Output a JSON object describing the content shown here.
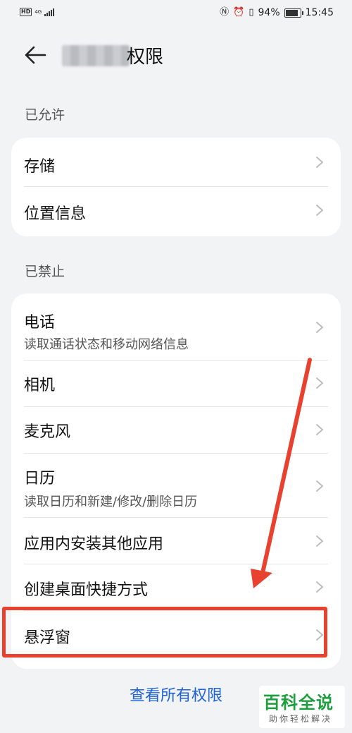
{
  "status_bar": {
    "hd": "HD",
    "network": "4G",
    "battery": "94%",
    "battery_level": 0.94,
    "time": "15:45",
    "icons": [
      "nfc-icon",
      "alarm-icon",
      "vibrate-icon"
    ]
  },
  "header": {
    "title": "权限",
    "back_icon": "arrow-left-icon"
  },
  "allowed": {
    "label": "已允许",
    "items": [
      {
        "label": "存储"
      },
      {
        "label": "位置信息"
      }
    ]
  },
  "denied": {
    "label": "已禁止",
    "items": [
      {
        "label": "电话",
        "desc": "读取通话状态和移动网络信息"
      },
      {
        "label": "相机"
      },
      {
        "label": "麦克风"
      },
      {
        "label": "日历",
        "desc": "读取日历和新建/修改/删除日历"
      },
      {
        "label": "应用内安装其他应用"
      },
      {
        "label": "创建桌面快捷方式"
      },
      {
        "label": "悬浮窗"
      }
    ]
  },
  "footer": {
    "view_all": "查看所有权限"
  },
  "watermark": {
    "title": "百科全说",
    "subtitle": "助你轻松解决"
  },
  "colors": {
    "accent": "#1f63d6",
    "annotation": "#e8412f",
    "background": "#f1f3f5",
    "watermark_green": "#1c9e3e"
  }
}
